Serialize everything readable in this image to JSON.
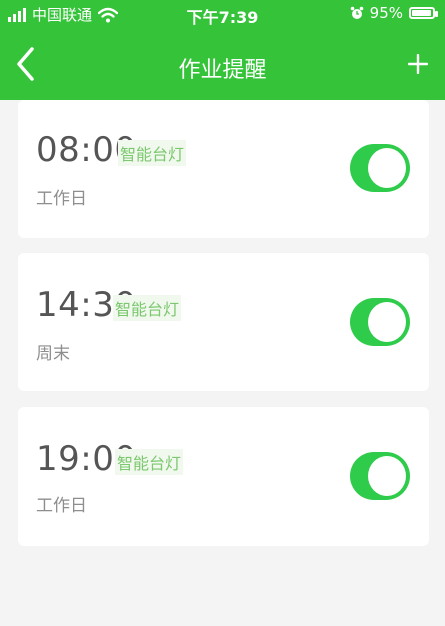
{
  "status_bar": {
    "carrier": "中国联通",
    "time": "下午7:39",
    "battery": "95%",
    "battery_level": 0.95
  },
  "nav": {
    "title": "作业提醒",
    "back_icon": "chevron-left-icon",
    "add_icon": "plus-icon"
  },
  "reminders": [
    {
      "time": "08:00",
      "device": "智能台灯",
      "repeat": "工作日",
      "enabled": true
    },
    {
      "time": "14:30",
      "device": "智能台灯",
      "repeat": "周末",
      "enabled": true
    },
    {
      "time": "19:00",
      "device": "智能台灯",
      "repeat": "工作日",
      "enabled": true
    }
  ],
  "colors": {
    "header": "#35c33a",
    "toggle_on": "#2ecc4a",
    "device_tag": "#7bc86e",
    "background": "#f4f4f4"
  }
}
